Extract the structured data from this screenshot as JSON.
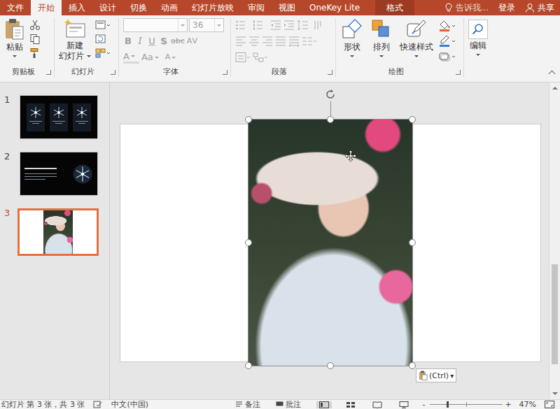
{
  "tabs": [
    {
      "label": "文件",
      "selected": false,
      "kind": "plain"
    },
    {
      "label": "开始",
      "selected": true,
      "kind": "plain"
    },
    {
      "label": "插入",
      "selected": false,
      "kind": "plain"
    },
    {
      "label": "设计",
      "selected": false,
      "kind": "plain"
    },
    {
      "label": "切换",
      "selected": false,
      "kind": "plain"
    },
    {
      "label": "动画",
      "selected": false,
      "kind": "plain"
    },
    {
      "label": "幻灯片放映",
      "selected": false,
      "kind": "plain"
    },
    {
      "label": "审阅",
      "selected": false,
      "kind": "plain"
    },
    {
      "label": "视图",
      "selected": false,
      "kind": "plain"
    },
    {
      "label": "OneKey Lite",
      "selected": false,
      "kind": "plain"
    },
    {
      "label": "格式",
      "selected": false,
      "kind": "contextual"
    }
  ],
  "tell_me": {
    "placeholder": "告诉我..."
  },
  "account": {
    "sign_in": "登录",
    "share": "共享"
  },
  "ribbon": {
    "clipboard": {
      "label": "剪贴板",
      "paste": "粘贴"
    },
    "slides": {
      "label": "幻灯片",
      "new_slide": [
        "新建",
        "幻灯片"
      ]
    },
    "font": {
      "label": "字体",
      "disabled": true,
      "name": "",
      "size": "36",
      "styles": [
        {
          "label": "B",
          "kind": "bold"
        },
        {
          "label": "I",
          "kind": "italic"
        },
        {
          "label": "U",
          "kind": "underline"
        },
        {
          "label": "S",
          "kind": "shadow"
        },
        {
          "label": "abc",
          "kind": "strike"
        },
        {
          "label": "AV",
          "kind": "spacing"
        }
      ],
      "effects": [
        {
          "label": "A",
          "kind": "color"
        },
        {
          "label": "Aa",
          "kind": "case"
        },
        {
          "label": "A",
          "kind": "highlight"
        }
      ]
    },
    "paragraph": {
      "label": "段落",
      "disabled": true
    },
    "drawing": {
      "label": "绘图",
      "tools": [
        {
          "label": "形状",
          "kind": "shapes"
        },
        {
          "label": "排列",
          "kind": "arrange"
        },
        {
          "label": "快速样式",
          "kind": "styles"
        }
      ]
    },
    "editing": {
      "label": "编辑"
    }
  },
  "slides": [
    {
      "number": "1",
      "selected": false,
      "kind": "snowflakes"
    },
    {
      "number": "2",
      "selected": false,
      "kind": "text"
    },
    {
      "number": "3",
      "selected": true,
      "kind": "photo"
    }
  ],
  "canvas": {
    "picture_selected": true,
    "paste_options": {
      "label": "(Ctrl)",
      "arrow": "▾"
    }
  },
  "scrollbar": {
    "offset": 0.58,
    "size": 0.34
  },
  "status_bar": {
    "slide_info": "幻灯片 第 3 张，共 3 张",
    "language": "中文(中国)",
    "notes": "备注",
    "comments": "批注",
    "views": [
      {
        "kind": "normal",
        "selected": true
      },
      {
        "kind": "sorter",
        "selected": false
      },
      {
        "kind": "reading",
        "selected": false
      },
      {
        "kind": "slideshow",
        "selected": false
      }
    ],
    "zoom_out": "-",
    "zoom_in": "+",
    "zoom_level": 0.24,
    "zoom": "47%"
  }
}
